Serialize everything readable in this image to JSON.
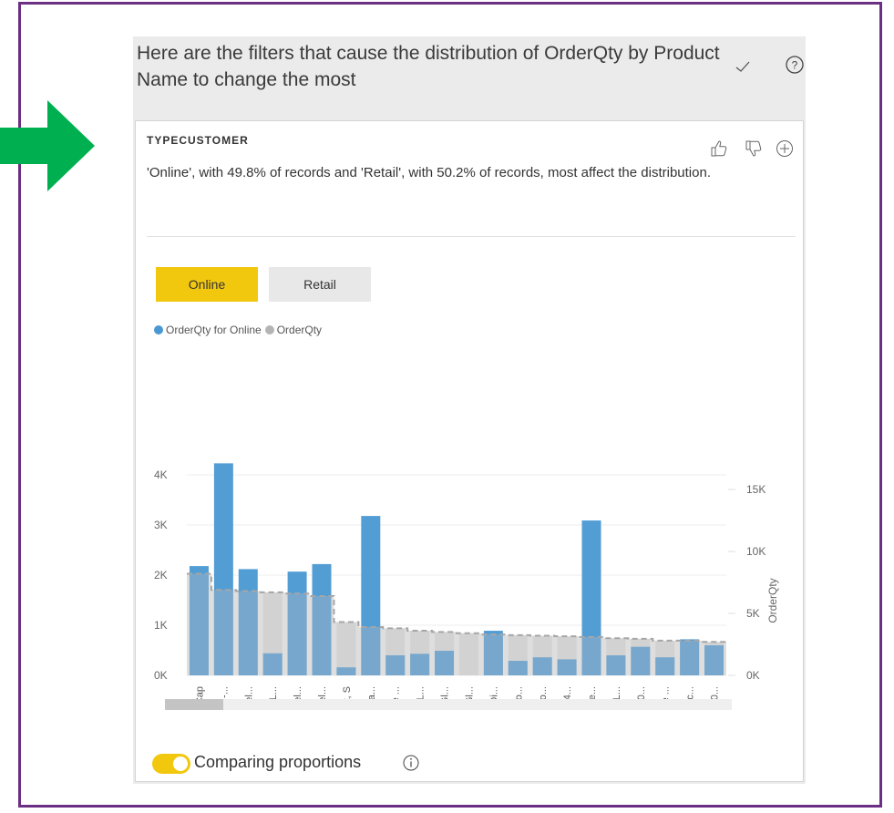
{
  "header": {
    "title": "Here are the filters that cause the distribution of OrderQty by Product Name to change the most"
  },
  "icons": {
    "check": "check-icon",
    "help": "help-icon",
    "thumb_up": "thumb-up-icon",
    "thumb_down": "thumb-down-icon",
    "add": "plus-icon",
    "info": "info-icon",
    "arrow": "arrow-right-icon"
  },
  "colors": {
    "frame": "#6b2f83",
    "arrow": "#00b050",
    "online_bar": "#4a98d3",
    "overall_bar": "#c8c8c8",
    "selected_button": "#f2c80f"
  },
  "insight": {
    "title": "TYPECUSTOMER",
    "description": "'Online', with 49.8% of records and 'Retail', with 50.2% of records, most affect the distribution."
  },
  "segments": {
    "online": "Online",
    "retail": "Retail",
    "selected": "Online"
  },
  "legend": {
    "series1": "OrderQty for Online",
    "series2": "OrderQty"
  },
  "toggle": {
    "label": "Comparing proportions",
    "state": "on"
  },
  "chart_data": {
    "type": "bar",
    "categories": [
      "AWC Logo Cap",
      "Water Bottle -...",
      "Sport-100 Hel...",
      "Long-Sleeve L...",
      "Sport-100 Hel...",
      "Sport-100 Hel...",
      "Classic Vest, S",
      "Patch Kit/8 Pa...",
      "Short-Sleeve ...",
      "Long-Sleeve L...",
      "Half-Finger Gl...",
      "Full-Finger Gl...",
      "Bike Wash - Di...",
      "Women's Mo...",
      "Women's Mo...",
      "Hitch Rack - 4...",
      "Mountain Tire...",
      "Long-Sleeve L...",
      "Mountain-200...",
      "Short-Sleeve ...",
      "Hydration Pac...",
      "Mountain-200..."
    ],
    "series": [
      {
        "name": "OrderQty for Online",
        "axis": "left",
        "values": [
          2180,
          4230,
          2120,
          440,
          2070,
          2220,
          160,
          3180,
          400,
          430,
          490,
          0,
          890,
          290,
          360,
          320,
          3090,
          400,
          570,
          360,
          720,
          600
        ]
      },
      {
        "name": "OrderQty",
        "axis": "right",
        "values": [
          8200,
          6900,
          6800,
          6700,
          6600,
          6400,
          4300,
          3900,
          3800,
          3600,
          3500,
          3400,
          3300,
          3250,
          3200,
          3150,
          3100,
          3000,
          2950,
          2800,
          2800,
          2700
        ]
      }
    ],
    "left_axis": {
      "ticks": [
        "0K",
        "1K",
        "2K",
        "3K",
        "4K"
      ],
      "ylim": [
        0,
        4400
      ]
    },
    "right_axis": {
      "label": "OrderQty",
      "ticks": [
        "0K",
        "5K",
        "10K",
        "15K"
      ],
      "ylim": [
        0,
        17800
      ]
    },
    "legend": "top-left",
    "grid": true
  }
}
